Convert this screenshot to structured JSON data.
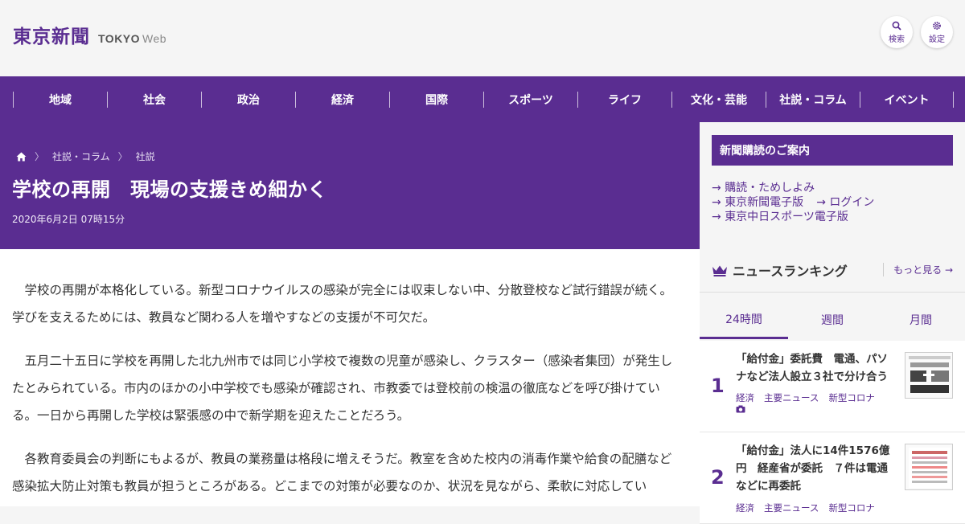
{
  "header": {
    "logo_jp": "東京新聞",
    "logo_en": "TOKYO",
    "logo_web": "Web",
    "search_label": "検索",
    "settings_label": "設定"
  },
  "nav": {
    "items": [
      "地域",
      "社会",
      "政治",
      "経済",
      "国際",
      "スポーツ",
      "ライフ",
      "文化・芸能",
      "社説・コラム",
      "イベント"
    ]
  },
  "breadcrumb": {
    "items": [
      "社説・コラム",
      "社説"
    ]
  },
  "article": {
    "title": "学校の再開　現場の支援きめ細かく",
    "date": "2020年6月2日 07時15分",
    "paragraphs": [
      "学校の再開が本格化している。新型コロナウイルスの感染が完全には収束しない中、分散登校など試行錯誤が続く。学びを支えるためには、教員など関わる人を増やすなどの支援が不可欠だ。",
      "五月二十五日に学校を再開した北九州市では同じ小学校で複数の児童が感染し、クラスター（感染者集団）が発生したとみられている。市内のほかの小中学校でも感染が確認され、市教委では登校前の検温の徹底などを呼び掛けている。一日から再開した学校は緊張感の中で新学期を迎えたことだろう。",
      "各教育委員会の判断にもよるが、教員の業務量は格段に増えそうだ。教室を含めた校内の消毒作業や給食の配膳など感染拡大防止対策も教員が担うところがある。どこまでの対策が必要なのか、状況を見ながら、柔軟に対応してい"
    ]
  },
  "subscribe": {
    "heading": "新聞購読のご案内",
    "links": [
      "購読・ためしよみ",
      "東京新聞電子版",
      "ログイン",
      "東京中日スポーツ電子版"
    ]
  },
  "ranking": {
    "heading": "ニュースランキング",
    "more": "もっと見る",
    "tabs": [
      "24時間",
      "週間",
      "月間"
    ],
    "items": [
      {
        "rank": "1",
        "title": "「給付金」委託費　電通、パソナなど法人設立３社で分け合う",
        "tags": [
          "経済",
          "主要ニュース",
          "新型コロナ"
        ]
      },
      {
        "rank": "2",
        "title": "「給付金」法人に14件1576億円　経産省が委託　７件は電通などに再委託",
        "tags": [
          "経済",
          "主要ニュース",
          "新型コロナ"
        ]
      }
    ]
  },
  "colors": {
    "brand": "#5a2d91"
  }
}
